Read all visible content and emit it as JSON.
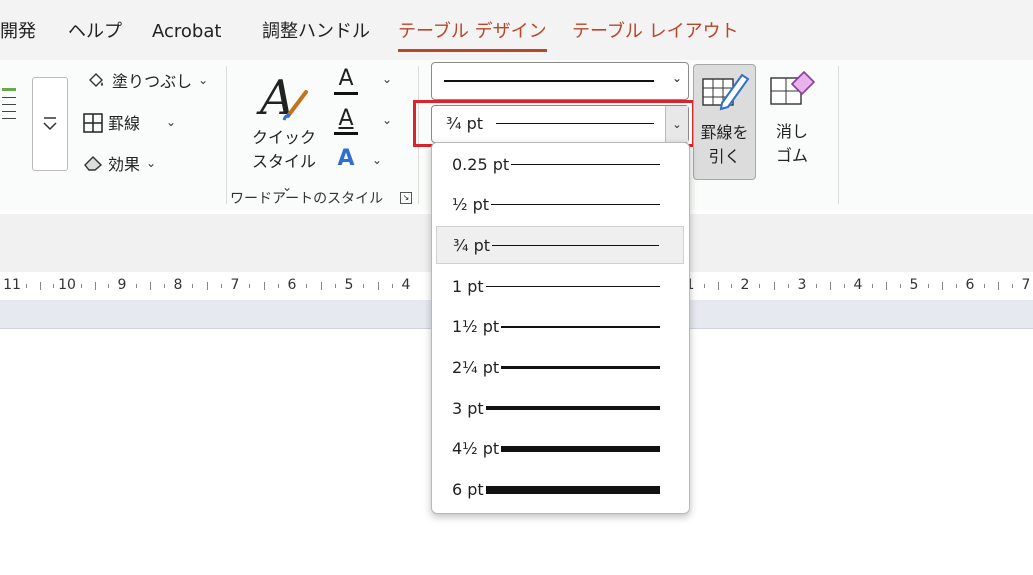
{
  "tabs": [
    {
      "label": "開発"
    },
    {
      "label": "ヘルプ"
    },
    {
      "label": "Acrobat"
    },
    {
      "label": "調整ハンドル"
    },
    {
      "label": "テーブル デザイン"
    },
    {
      "label": "テーブル レイアウト"
    }
  ],
  "ribbon": {
    "shading": {
      "label": "塗りつぶし"
    },
    "borders": {
      "label": "罫線"
    },
    "effects": {
      "label": "効果"
    },
    "quick_style": {
      "line1": "クイック",
      "line2": "スタイル"
    },
    "letter": "A",
    "wordart_group_label": "ワードアートのスタイル",
    "pen_style_value": "",
    "pen_weight_value": "¾ pt",
    "draw_table": {
      "line1": "罫線を",
      "line2": "引く"
    },
    "eraser": {
      "line1": "消し",
      "line2": "ゴム"
    }
  },
  "ruler": {
    "labels": [
      "11",
      "10",
      "9",
      "8",
      "7",
      "6",
      "5",
      "4",
      "1",
      "2",
      "3",
      "4",
      "5",
      "6",
      "7"
    ]
  },
  "weight_options": [
    {
      "label": "0.25 pt",
      "weight": 0.25,
      "selected": false
    },
    {
      "label": "½ pt",
      "weight": 0.5,
      "selected": false
    },
    {
      "label": "¾ pt",
      "weight": 0.75,
      "selected": true
    },
    {
      "label": "1 pt",
      "weight": 1,
      "selected": false
    },
    {
      "label": "1½ pt",
      "weight": 1.5,
      "selected": false
    },
    {
      "label": "2¼ pt",
      "weight": 2.25,
      "selected": false
    },
    {
      "label": "3 pt",
      "weight": 3,
      "selected": false
    },
    {
      "label": "4½ pt",
      "weight": 4.5,
      "selected": false
    },
    {
      "label": "6 pt",
      "weight": 6,
      "selected": false
    }
  ],
  "colors": {
    "accent": "#b7472a",
    "highlight": "#d9242b",
    "wordart_blue": "#2f6fd1"
  }
}
